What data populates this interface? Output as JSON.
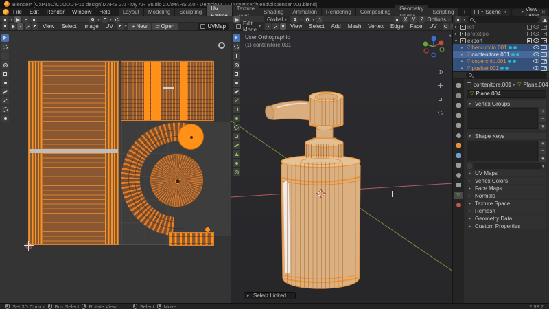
{
  "window": {
    "title": "Blender* [C:\\P15D\\CLOUD P15 design\\MARS 2.0 - My AR Studio 2.0\\MARS 2.0 - Demo\\M2.0 - Dispenser\\blend\\dispenser v01.blend]"
  },
  "topbar": {
    "menus": [
      "File",
      "Edit",
      "Render",
      "Window",
      "Help"
    ],
    "workspaces": [
      "Layout",
      "Modeling",
      "Sculpting",
      "UV Editing",
      "Texture Paint",
      "Shading",
      "Animation",
      "Rendering",
      "Compositing",
      "Geometry Nodes",
      "Scripting"
    ],
    "active_workspace": "UV Editing",
    "add_workspace": "+",
    "scene_name": "Scene",
    "view_layer_name": "View Layer"
  },
  "uv_editor": {
    "menus": [
      "View",
      "Select",
      "Image",
      "UV"
    ],
    "new_image": "New",
    "open_image": "Open",
    "uv_map": "UVMap"
  },
  "viewport3d": {
    "mode": "Edit Mode",
    "menus": [
      "View",
      "Select",
      "Add",
      "Mesh",
      "Vertex",
      "Edge",
      "Face",
      "UV"
    ],
    "orientation": "Global",
    "options_label": "Options",
    "axis_toggles": [
      "X",
      "Y",
      "Z"
    ],
    "overlay": {
      "view_label": "User Orthographic",
      "object_label": "(1) contenitore.001"
    },
    "operator_panel": "Select Linked"
  },
  "outliner": {
    "collections": [
      {
        "name": "ref"
      },
      {
        "name": "prototipo"
      },
      {
        "name": "export"
      }
    ],
    "objects": [
      {
        "name": "beccuccio.001"
      },
      {
        "name": "contenitore.001"
      },
      {
        "name": "coperchio.001"
      },
      {
        "name": "pusher.001"
      }
    ],
    "active_object": "contenitore.001"
  },
  "properties": {
    "breadcrumb": {
      "object": "contenitore.001",
      "data": "Plane.004"
    },
    "data_name": "Plane.004",
    "panels": [
      "Vertex Groups",
      "Shape Keys",
      "UV Maps",
      "Vertex Colors",
      "Face Maps",
      "Normals",
      "Texture Space",
      "Remesh",
      "Geometry Data",
      "Custom Properties"
    ]
  },
  "statusbar": {
    "hints": [
      "Set 3D Cursor",
      "Box Select",
      "Rotate View",
      "Select",
      "Move"
    ],
    "version": "2.93.2"
  },
  "colors": {
    "accent_blue": "#4772b3",
    "selection_orange": "#ff9018",
    "island_fill": "#8a5733",
    "island_edge": "#d9812d",
    "bottle_fill": "#dcb181",
    "wire_orange": "#ef9434",
    "outliner_selected": "#34517c",
    "outliner_active": "#46689a"
  }
}
